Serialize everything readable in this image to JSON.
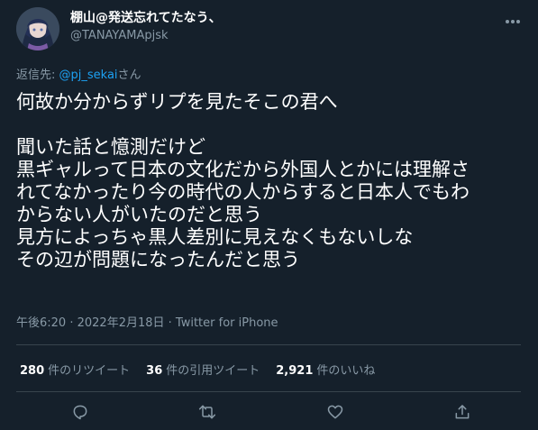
{
  "author": {
    "display_name": "棚山@発送忘れてたなう、",
    "handle": "@TANAYAMApjsk",
    "avatar_icon": "profile-avatar"
  },
  "reply": {
    "prefix": "返信先: ",
    "mention": "@pj_sekai",
    "suffix": "さん"
  },
  "tweet": {
    "lines": [
      "何故か分からずリプを見たそこの君へ",
      "",
      "聞いた話と憶測だけど",
      "黒ギャルって日本の文化だから外国人とかには理解さ",
      "れてなかったり今の時代の人からすると日本人でもわ",
      "からない人がいたのだと思う",
      "見方によっちゃ黒人差別に見えなくもないしな",
      "その辺が問題になったんだと思う"
    ]
  },
  "meta": {
    "time": "午後6:20",
    "separator": " · ",
    "date": "2022年2月18日",
    "separator2": " · ",
    "client": "Twitter for iPhone"
  },
  "stats": {
    "retweets_count": "280",
    "retweets_label": "件のリツイート",
    "quotes_count": "36",
    "quotes_label": "件の引用ツイート",
    "likes_count": "2,921",
    "likes_label": "件のいいね"
  },
  "actions": {
    "reply_icon": "reply-icon",
    "retweet_icon": "retweet-icon",
    "like_icon": "heart-icon",
    "share_icon": "share-icon"
  },
  "colors": {
    "background": "#15202b",
    "text": "#ffffff",
    "muted": "#8899a6",
    "link": "#1da1f2",
    "divider": "#38444d"
  }
}
